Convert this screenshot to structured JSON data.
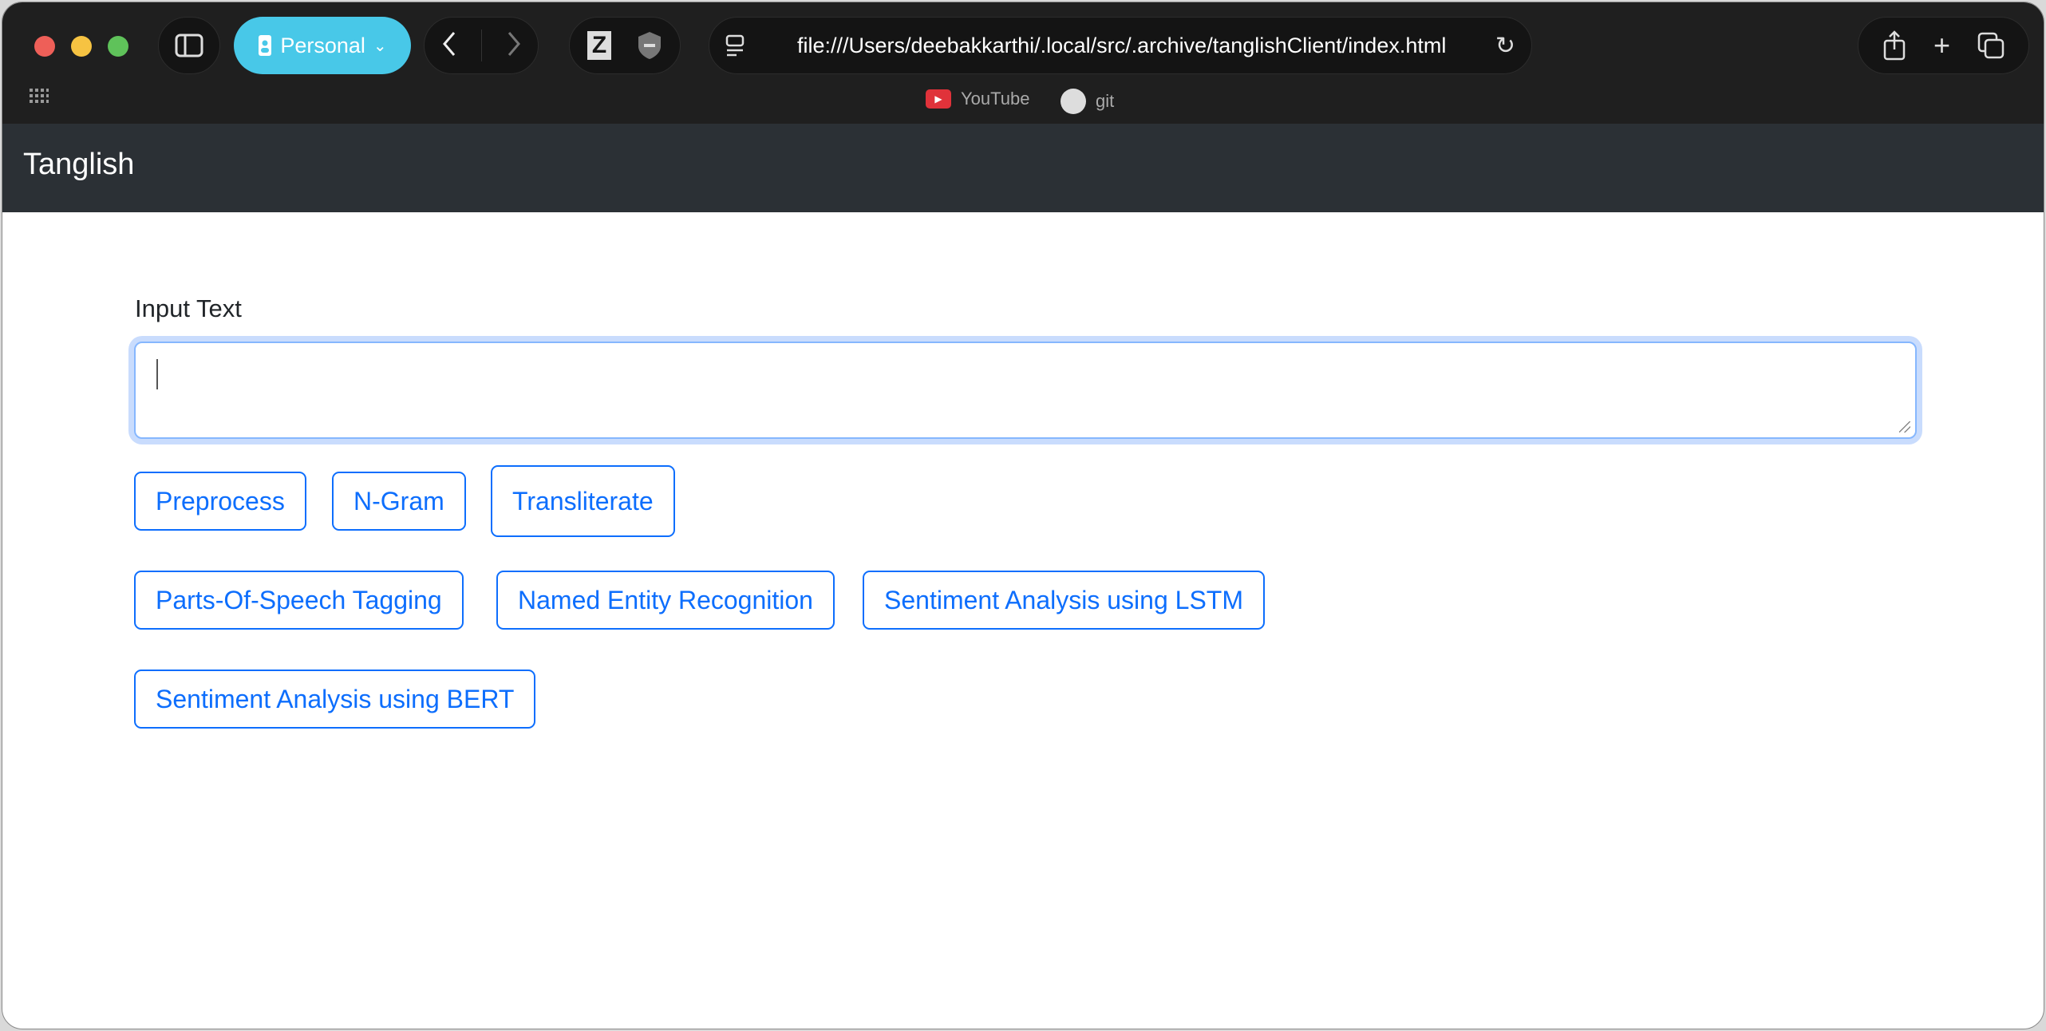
{
  "browser": {
    "profile_label": "Personal",
    "url": "file:///Users/deebakkarthi/.local/src/.archive/tanglishClient/index.html",
    "bookmarks": [
      {
        "label": "YouTube",
        "icon": "youtube-icon"
      },
      {
        "label": "git",
        "icon": "github-icon"
      }
    ],
    "colors": {
      "profile": "#48c8e8",
      "chrome": "#1f1f1f"
    }
  },
  "navbar": {
    "brand": "Tanglish",
    "bg": "#2b3035"
  },
  "form": {
    "label": "Input Text",
    "value": "",
    "placeholder": ""
  },
  "buttons": [
    "Preprocess",
    "N-Gram",
    "Transliterate",
    "Parts-Of-Speech Tagging",
    "Named Entity Recognition",
    "Sentiment Analysis using LSTM",
    "Sentiment Analysis using BERT"
  ],
  "accent": "#0d6efd"
}
